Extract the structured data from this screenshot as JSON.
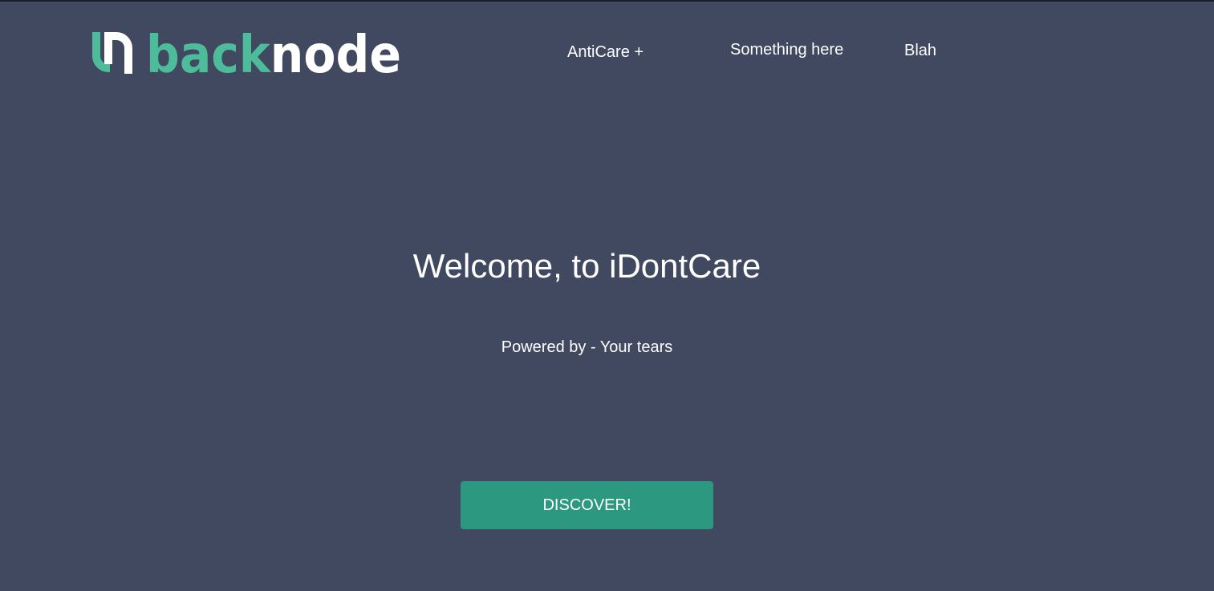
{
  "brand": {
    "name_part1": "back",
    "name_part2": "node",
    "colors": {
      "accent": "#4dbc9b",
      "text": "#ffffff",
      "background": "#414961",
      "button": "#2d9880"
    }
  },
  "nav": {
    "items": [
      {
        "label": "AntiCare +"
      },
      {
        "label": "Something here"
      },
      {
        "label": "Blah"
      }
    ]
  },
  "hero": {
    "title": "Welcome, to iDontCare",
    "subtitle": "Powered by - Your tears",
    "cta_label": "DISCOVER!"
  }
}
